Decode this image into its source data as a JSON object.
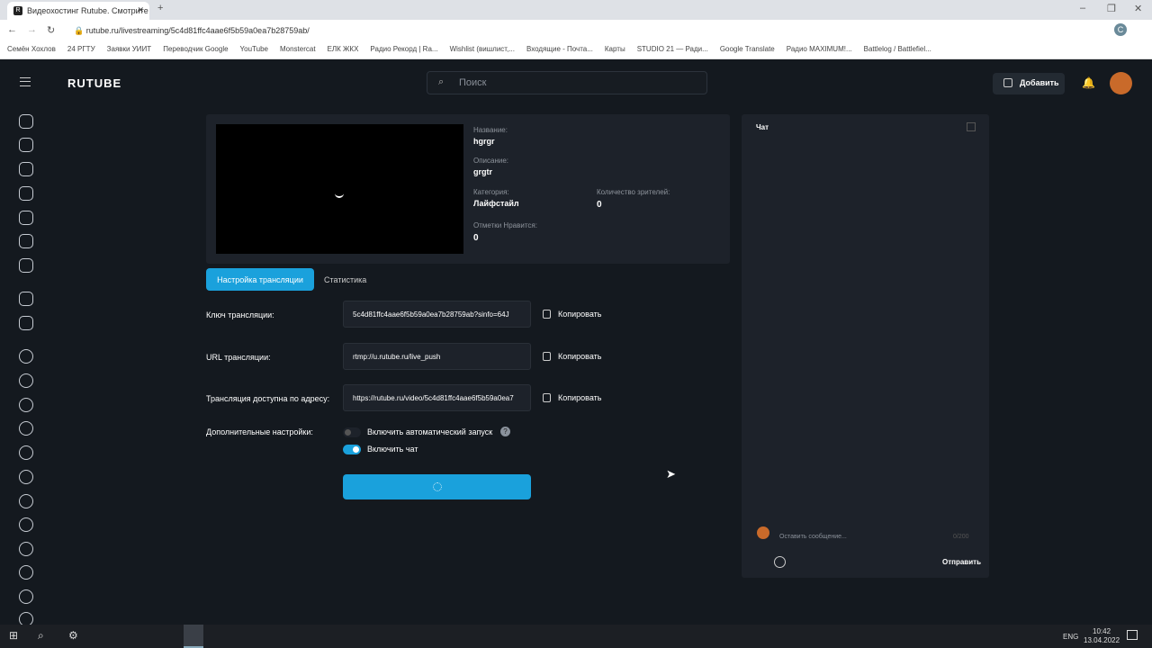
{
  "browser": {
    "tab_title": "Видеохостинг Rutube. Смотрите",
    "url": "rutube.ru/livestreaming/5c4d81ffc4aae6f5b59a0ea7b28759ab/",
    "bookmarks": [
      "Семён Хохлов",
      "24 РГТУ",
      "Заявки УИИТ",
      "Переводчик Google",
      "YouTube",
      "Monstercat",
      "ЕЛК ЖКХ",
      "Радио Рекорд | Ra...",
      "Wishlist (вишлист,...",
      "Входящие - Почта...",
      "Карты",
      "STUDIO 21 — Ради...",
      "Google Translate",
      "Радио MAXIMUM!...",
      "Battlelog / Battlefiel..."
    ]
  },
  "header": {
    "logo": "RUTUBE",
    "search_placeholder": "Поиск",
    "add_label": "Добавить"
  },
  "stream": {
    "name_label": "Название:",
    "name": "hgrgr",
    "desc_label": "Описание:",
    "desc": "grgtr",
    "category_label": "Категория:",
    "category": "Лайфстайл",
    "viewers_label": "Количество зрителей:",
    "viewers": "0",
    "likes_label": "Отметки Нравится:",
    "likes": "0"
  },
  "tabs": {
    "settings": "Настройка трансляции",
    "stats": "Статистика"
  },
  "fields": [
    {
      "label": "Ключ трансляции:",
      "value": "5c4d81ffc4aae6f5b59a0ea7b28759ab?sinfo=64J",
      "copy": "Копировать"
    },
    {
      "label": "URL трансляции:",
      "value": "rtmp://u.rutube.ru/live_push",
      "copy": "Копировать"
    },
    {
      "label": "Трансляция доступна по адресу:",
      "value": "https://rutube.ru/video/5c4d81ffc4aae6f5b59a0ea7",
      "copy": "Копировать"
    }
  ],
  "extra": {
    "label": "Дополнительные настройки:",
    "autostart": "Включить автоматический запуск",
    "autostart_on": false,
    "chat": "Включить чат",
    "chat_on": true
  },
  "chat": {
    "title": "Чат",
    "placeholder": "Оставить сообщение...",
    "counter": "0/200",
    "send": "Отправить"
  },
  "taskbar": {
    "lang": "ENG",
    "time": "10:42",
    "date": "13.04.2022"
  },
  "colors": {
    "accent": "#1aa1dc"
  }
}
